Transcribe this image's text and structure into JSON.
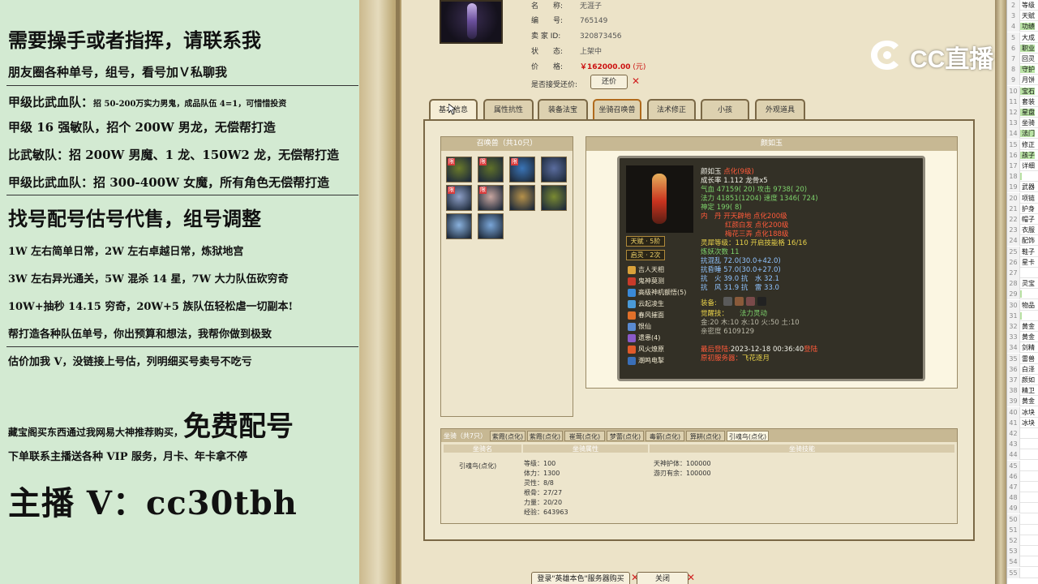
{
  "left_panel": {
    "headline": "需要操手或者指挥，请联系我",
    "line_wechat": "朋友圈各种单号，组号，看号加Ｖ私聊我",
    "team_a_title": "甲级比武血队：",
    "team_a_detail": "招 50-200万实力男鬼，成品队伍 4=1，可惜惜投资",
    "team_b": "甲级 16 强敏队，招个 200W 男龙，无偿帮打造",
    "team_c": "比武敏队：招 200W 男魔、1 龙、150W2 龙，无偿帮打造",
    "team_d": "甲级比武血队：招 300-400W 女魔，所有角色无偿帮打造",
    "service_title": "找号配号估号代售，组号调整",
    "service_1": "1W 左右简单日常，2W 左右卓越日常，炼狱地宫",
    "service_2": "3W 左右异光通关，5W 混杀 14 星，7W 大力队伍砍穷奇",
    "service_3": "10W+抽秒 14.15 穷奇，20W+5 族队伍轻松虐一切副本!",
    "service_4": "帮打造各种队伍单号，你出预算和想法，我帮你做到极致",
    "appraise": "估价加我 V，没链接上号估，列明细买号卖号不吃亏",
    "free_prefix": "藏宝阁买东西通过我网易大神推荐购买，",
    "free_big": "免费配号",
    "vip": "下单联系主播送各种 VIP 服务，月卡、年卡拿不停",
    "streamer": "主播 V：cc30tbh"
  },
  "listing": {
    "name_label": "名　　称:",
    "name_value": "无涯子",
    "id_label": "编　　号:",
    "id_value": "765149",
    "seller_label": "卖 家 ID:",
    "seller_value": "320873456",
    "status_label": "状　　态:",
    "status_value": "上架中",
    "price_label": "价　　格:",
    "price_value": "￥162000.00",
    "price_unit": "(元)",
    "haggle_label": "是否接受还价:",
    "haggle_button": "还价"
  },
  "tabs": [
    {
      "label": "基本信息"
    },
    {
      "label": "属性抗性"
    },
    {
      "label": "装备法宝"
    },
    {
      "label": "坐骑召唤兽"
    },
    {
      "label": "法术修正"
    },
    {
      "label": "小孩"
    },
    {
      "label": "外观道具"
    }
  ],
  "summon_panel": {
    "title": "召唤兽（共10只）",
    "pets": [
      {
        "tag": "限",
        "color": "#6a7a2a"
      },
      {
        "tag": "限",
        "color": "#5f7029"
      },
      {
        "tag": "限",
        "color": "#3a74b6"
      },
      {
        "tag": "",
        "color": "#5a6c9e"
      },
      {
        "tag": "限",
        "color": "#8ea0c8"
      },
      {
        "tag": "限",
        "color": "#c8a6a0"
      },
      {
        "tag": "",
        "color": "#b5914a"
      },
      {
        "tag": "",
        "color": "#7a8a32"
      },
      {
        "tag": "",
        "color": "#8ab2de"
      },
      {
        "tag": "",
        "color": "#7aa6d8"
      }
    ]
  },
  "detail": {
    "header": "颜如玉",
    "pet_name": "颜如玉",
    "pet_tag": "点化(9级)",
    "growth": "成长率 1.112 龙骨x5",
    "hp": "气血 47159( 20)",
    "attack": "攻击 9738( 20)",
    "mp": "法力 41851(1204)",
    "speed": "速度 1346( 724)",
    "spirit": "神定 199( 8)",
    "pill_label": "内　丹",
    "pill_1": "开天辟地 点化200级",
    "pill_2": "红颜白发 点化200级",
    "pill_3": "梅花三弄 点化188级",
    "aura": "灵犀等级：110 开启技能格 16/16",
    "tame": "炼妖次数 11",
    "res_seal": "抗混乱 72.0(30.0+42.0)",
    "res_sleep": "抗昏睡 57.0(30.0+27.0)",
    "res_fire": "抗　火 39.0 抗　水 32.1",
    "res_wind": "抗　风 31.9 抗　雷 33.0",
    "badge_1": "天赋 · 5阶",
    "badge_2": "启灵 · 2次",
    "skills": [
      "吉人天相",
      "鬼神莫测",
      "高级神机额悟(5)",
      "云起凌生",
      "春风摧面",
      "恨仙",
      "遗患(4)",
      "风火燎原",
      "潮鸣电掣"
    ],
    "equip_label": "装备:",
    "awaken_label": "觉醒技：",
    "awaken_skill": "法力灵动",
    "elements": "金:20 木:10 水:10 火:50 土:10",
    "ident": "亲密度 6109129",
    "reg_label": "最后登陆:",
    "reg_value": "2023-12-18 00:36:40",
    "reg_suffix": "登陆",
    "server_label": "原初服务器：",
    "server_value": "飞花逐月"
  },
  "mount_panel": {
    "title": "坐骑（共7只）",
    "tabs": [
      "紫霞(点化)",
      "紫霞(点化)",
      "崔莺(点化)",
      "梦蕾(点化)",
      "毒箭(点化)",
      "算耕(点化)",
      "引魂鸟(点化)"
    ],
    "col_1": "坐骑名",
    "col_2": "坐骑属性",
    "col_3": "坐骑技能",
    "mount_name": "引魂鸟(点化)",
    "stats": [
      "等级：100",
      "体力：1300",
      "灵性：8/8",
      "根骨：27/27",
      "力量：20/20",
      "经验：643963"
    ],
    "skills": [
      "天神护体：100000",
      "游刃有余：100000"
    ]
  },
  "bottom": {
    "login_button": "登录\"英雄本色\"服务器购买",
    "close_button": "关闭"
  },
  "excel": {
    "rows": [
      {
        "n": "2",
        "t": "等级"
      },
      {
        "n": "3",
        "t": "天赋"
      },
      {
        "n": "4",
        "t": "功绩"
      },
      {
        "n": "5",
        "t": "大成"
      },
      {
        "n": "6",
        "t": "职业"
      },
      {
        "n": "7",
        "t": "回灵"
      },
      {
        "n": "8",
        "t": "守护"
      },
      {
        "n": "9",
        "t": "月饼"
      },
      {
        "n": "10",
        "t": "宝石"
      },
      {
        "n": "11",
        "t": "套装"
      },
      {
        "n": "12",
        "t": "星盘"
      },
      {
        "n": "13",
        "t": "坐骑"
      },
      {
        "n": "14",
        "t": "法门"
      },
      {
        "n": "15",
        "t": "修正"
      },
      {
        "n": "16",
        "t": "孩子"
      },
      {
        "n": "17",
        "t": "详细"
      },
      {
        "n": "18",
        "t": ""
      },
      {
        "n": "19",
        "t": "武器"
      },
      {
        "n": "20",
        "t": "项链"
      },
      {
        "n": "21",
        "t": "护身"
      },
      {
        "n": "22",
        "t": "帽子"
      },
      {
        "n": "23",
        "t": "衣服"
      },
      {
        "n": "24",
        "t": "配饰"
      },
      {
        "n": "25",
        "t": "鞋子"
      },
      {
        "n": "26",
        "t": "星卡"
      },
      {
        "n": "27",
        "t": ""
      },
      {
        "n": "28",
        "t": "灵宝"
      },
      {
        "n": "29",
        "t": ""
      },
      {
        "n": "30",
        "t": "物品"
      },
      {
        "n": "31",
        "t": ""
      },
      {
        "n": "32",
        "t": "黄金"
      },
      {
        "n": "33",
        "t": "黄金"
      },
      {
        "n": "34",
        "t": "剑精"
      },
      {
        "n": "35",
        "t": "雷兽"
      },
      {
        "n": "36",
        "t": "白泽"
      },
      {
        "n": "37",
        "t": "颜如"
      },
      {
        "n": "38",
        "t": "精卫"
      },
      {
        "n": "39",
        "t": "黄金"
      },
      {
        "n": "40",
        "t": "冰块"
      },
      {
        "n": "41",
        "t": "冰块"
      },
      {
        "n": "42",
        "t": ""
      },
      {
        "n": "43",
        "t": ""
      },
      {
        "n": "44",
        "t": ""
      },
      {
        "n": "45",
        "t": ""
      },
      {
        "n": "46",
        "t": ""
      },
      {
        "n": "47",
        "t": ""
      },
      {
        "n": "48",
        "t": ""
      },
      {
        "n": "49",
        "t": ""
      },
      {
        "n": "50",
        "t": ""
      },
      {
        "n": "51",
        "t": ""
      },
      {
        "n": "52",
        "t": ""
      },
      {
        "n": "53",
        "t": ""
      },
      {
        "n": "54",
        "t": ""
      },
      {
        "n": "55",
        "t": ""
      }
    ]
  },
  "logo": {
    "text": "CC直播"
  },
  "colors": {
    "overlay_bg": "#d3ead2",
    "price": "#cc1111",
    "card_bg": "#333026",
    "parchment": "#ece3c8"
  }
}
